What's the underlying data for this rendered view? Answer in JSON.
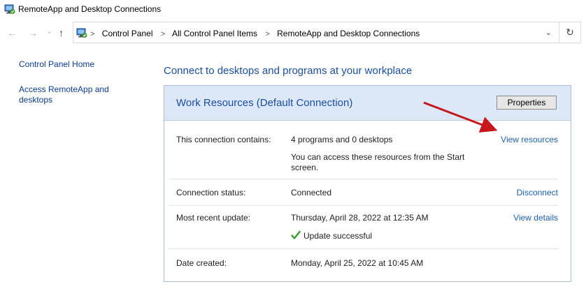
{
  "window": {
    "title": "RemoteApp and Desktop Connections"
  },
  "navigation": {
    "back_glyph": "←",
    "forward_glyph": "→",
    "recent_glyph": "⌄",
    "up_glyph": "↑",
    "breadcrumb": [
      "Control Panel",
      "All Control Panel Items",
      "RemoteApp and Desktop Connections"
    ],
    "dropdown_glyph": "⌄",
    "refresh_glyph": "↻"
  },
  "sidebar": {
    "home_link": "Control Panel Home",
    "access_link": "Access RemoteApp and desktops"
  },
  "main": {
    "heading": "Connect to desktops and programs at your workplace",
    "panel": {
      "title": "Work Resources (Default Connection)",
      "properties_label": "Properties",
      "rows": [
        {
          "label": "This connection contains:",
          "value": "4 programs and 0 desktops",
          "note": "You can access these resources from the Start screen.",
          "action": "View resources"
        },
        {
          "label": "Connection status:",
          "value": "Connected",
          "action": "Disconnect"
        },
        {
          "label": "Most recent update:",
          "value": "Thursday, April 28, 2022 at 12:35 AM",
          "status": "Update successful",
          "action": "View details"
        },
        {
          "label": "Date created:",
          "value": "Monday, April 25, 2022 at 10:45 AM"
        }
      ]
    }
  },
  "colors": {
    "link": "#1c5fb1",
    "heading": "#1a4ea1",
    "panel_header": "#dde8f6",
    "annotation_arrow": "#c8161d",
    "success_check": "#3a9b2d"
  },
  "icons": {
    "app": "remoteapp-icon",
    "check": "check-icon",
    "annotation": "red-arrow-icon"
  }
}
